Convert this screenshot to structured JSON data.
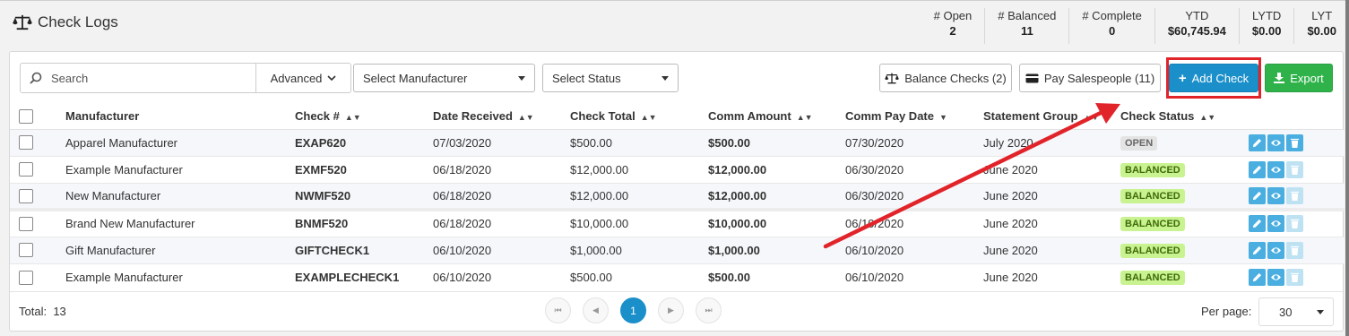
{
  "header": {
    "title": "Check Logs",
    "title_icon": "balance-scale-icon",
    "stats": [
      {
        "label": "# Open",
        "value": "2"
      },
      {
        "label": "# Balanced",
        "value": "11"
      },
      {
        "label": "# Complete",
        "value": "0"
      },
      {
        "label": "YTD",
        "value": "$60,745.94"
      },
      {
        "label": "LYTD",
        "value": "$0.00"
      },
      {
        "label": "LYT",
        "value": "$0.00"
      }
    ]
  },
  "toolbar": {
    "search_placeholder": "Search",
    "advanced_label": "Advanced",
    "manufacturer_select": "Select Manufacturer",
    "status_select": "Select Status",
    "balance_checks_label": "Balance Checks (2)",
    "pay_salespeople_label": "Pay Salespeople (11)",
    "add_check_label": "Add Check",
    "export_label": "Export"
  },
  "table": {
    "columns": [
      "Manufacturer",
      "Check #",
      "Date Received",
      "Check Total",
      "Comm Amount",
      "Comm Pay Date",
      "Statement Group",
      "Check Status"
    ],
    "rows": [
      {
        "manufacturer": "Apparel Manufacturer",
        "check": "EXAP620",
        "date": "07/03/2020",
        "total": "$500.00",
        "comm": "$500.00",
        "paydate": "07/30/2020",
        "group": "July 2020",
        "status": "OPEN"
      },
      {
        "manufacturer": "Example Manufacturer",
        "check": "EXMF520",
        "date": "06/18/2020",
        "total": "$12,000.00",
        "comm": "$12,000.00",
        "paydate": "06/30/2020",
        "group": "June 2020",
        "status": "BALANCED"
      },
      {
        "manufacturer": "New Manufacturer",
        "check": "NWMF520",
        "date": "06/18/2020",
        "total": "$12,000.00",
        "comm": "$12,000.00",
        "paydate": "06/30/2020",
        "group": "June 2020",
        "status": "BALANCED"
      },
      {
        "manufacturer": "Brand New Manufacturer",
        "check": "BNMF520",
        "date": "06/18/2020",
        "total": "$10,000.00",
        "comm": "$10,000.00",
        "paydate": "06/10/2020",
        "group": "June 2020",
        "status": "BALANCED"
      },
      {
        "manufacturer": "Gift Manufacturer",
        "check": "GIFTCHECK1",
        "date": "06/10/2020",
        "total": "$1,000.00",
        "comm": "$1,000.00",
        "paydate": "06/10/2020",
        "group": "June 2020",
        "status": "BALANCED"
      },
      {
        "manufacturer": "Example Manufacturer",
        "check": "EXAMPLECHECK1",
        "date": "06/10/2020",
        "total": "$500.00",
        "comm": "$500.00",
        "paydate": "06/10/2020",
        "group": "June 2020",
        "status": "BALANCED"
      }
    ]
  },
  "footer": {
    "total_label": "Total:",
    "total_value": "13",
    "current_page": "1",
    "per_page_label": "Per page:",
    "per_page_value": "30"
  },
  "colors": {
    "primary": "#1a8fc9",
    "success": "#2fb24a",
    "highlight": "#e0242a",
    "balanced_badge": "#c9f291"
  }
}
